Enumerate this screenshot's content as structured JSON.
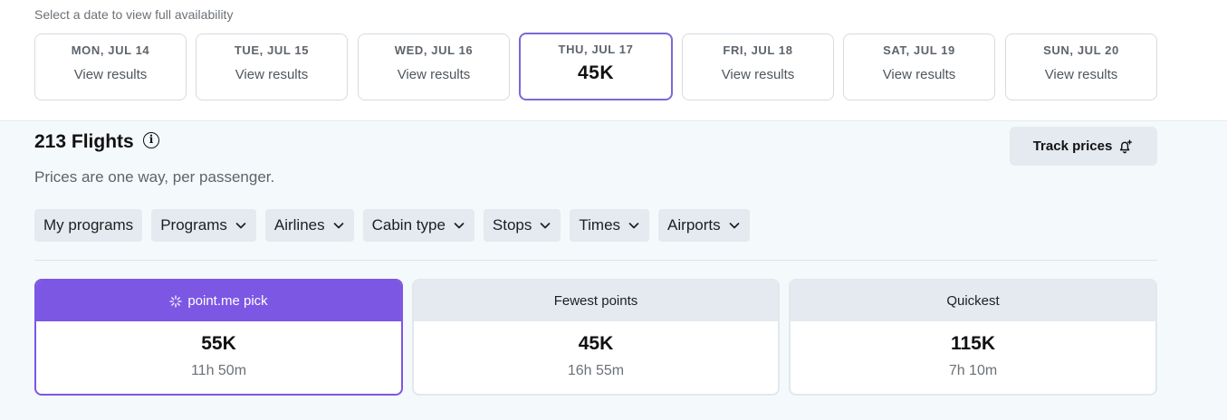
{
  "date_strip": {
    "hint": "Select a date to view full availability",
    "dates": [
      {
        "label": "MON, JUL 14",
        "value": "View results"
      },
      {
        "label": "TUE, JUL 15",
        "value": "View results"
      },
      {
        "label": "WED, JUL 16",
        "value": "View results"
      },
      {
        "label": "THU, JUL 17",
        "value": "45K"
      },
      {
        "label": "FRI, JUL 18",
        "value": "View results"
      },
      {
        "label": "SAT, JUL 19",
        "value": "View results"
      },
      {
        "label": "SUN, JUL 20",
        "value": "View results"
      }
    ]
  },
  "results": {
    "title": "213 Flights",
    "info_glyph": "i",
    "subtitle": "Prices are one way, per passenger.",
    "track_label": "Track prices"
  },
  "filters": [
    "My programs",
    "Programs",
    "Airlines",
    "Cabin type",
    "Stops",
    "Times",
    "Airports"
  ],
  "sort_options": [
    {
      "label": "point.me pick",
      "points": "55K",
      "duration": "11h 50m"
    },
    {
      "label": "Fewest points",
      "points": "45K",
      "duration": "16h 55m"
    },
    {
      "label": "Quickest",
      "points": "115K",
      "duration": "7h 10m"
    }
  ],
  "icons": {
    "info": "info-circle-icon",
    "track": "bell-plus-icon",
    "dropdown": "chevron-down-icon",
    "pick": "sparkle-icon"
  },
  "colors": {
    "accent": "#7b57e4",
    "selected_date_border": "#7b68d8",
    "chip_bg": "#e4eaef"
  }
}
